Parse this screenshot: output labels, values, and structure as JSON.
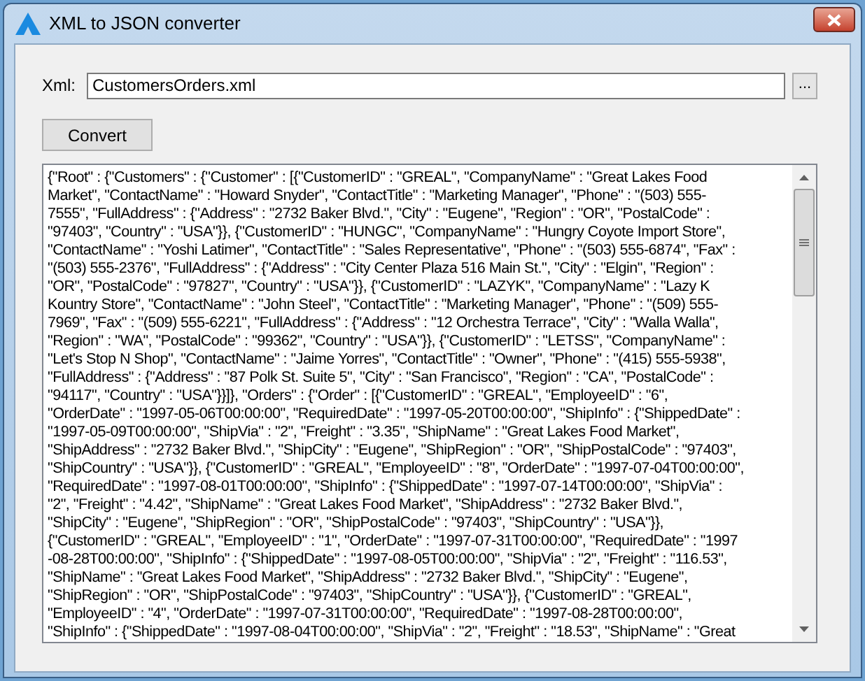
{
  "window": {
    "title": "XML to JSON converter"
  },
  "xml_field": {
    "label": "Xml:",
    "value": "CustomersOrders.xml"
  },
  "browse_button": "...",
  "convert_button": "Convert",
  "output_lines": [
    "{\"Root\" : {\"Customers\" : {\"Customer\" : [{\"CustomerID\" : \"GREAL\", \"CompanyName\" : \"Great Lakes Food",
    "Market\", \"ContactName\" : \"Howard Snyder\", \"ContactTitle\" : \"Marketing Manager\", \"Phone\" : \"(503) 555-",
    "7555\", \"FullAddress\" : {\"Address\" : \"2732 Baker Blvd.\", \"City\" : \"Eugene\", \"Region\" : \"OR\", \"PostalCode\" :",
    "\"97403\", \"Country\" : \"USA\"}}, {\"CustomerID\" : \"HUNGC\", \"CompanyName\" : \"Hungry Coyote Import Store\",",
    "\"ContactName\" : \"Yoshi Latimer\", \"ContactTitle\" : \"Sales Representative\", \"Phone\" : \"(503) 555-6874\", \"Fax\" :",
    "\"(503) 555-2376\", \"FullAddress\" : {\"Address\" : \"City Center Plaza 516 Main St.\", \"City\" : \"Elgin\", \"Region\" :",
    "\"OR\", \"PostalCode\" : \"97827\", \"Country\" : \"USA\"}}, {\"CustomerID\" : \"LAZYK\", \"CompanyName\" : \"Lazy K",
    "Kountry Store\", \"ContactName\" : \"John Steel\", \"ContactTitle\" : \"Marketing Manager\", \"Phone\" : \"(509) 555-",
    "7969\", \"Fax\" : \"(509) 555-6221\", \"FullAddress\" : {\"Address\" : \"12 Orchestra Terrace\", \"City\" : \"Walla Walla\",",
    "\"Region\" : \"WA\", \"PostalCode\" : \"99362\", \"Country\" : \"USA\"}}, {\"CustomerID\" : \"LETSS\", \"CompanyName\" :",
    "\"Let's Stop N Shop\", \"ContactName\" : \"Jaime Yorres\", \"ContactTitle\" : \"Owner\", \"Phone\" : \"(415) 555-5938\",",
    "\"FullAddress\" : {\"Address\" : \"87 Polk St. Suite 5\", \"City\" : \"San Francisco\", \"Region\" : \"CA\", \"PostalCode\" :",
    "\"94117\", \"Country\" : \"USA\"}}]}, \"Orders\" : {\"Order\" : [{\"CustomerID\" : \"GREAL\", \"EmployeeID\" : \"6\",",
    "\"OrderDate\" : \"1997-05-06T00:00:00\", \"RequiredDate\" : \"1997-05-20T00:00:00\", \"ShipInfo\" : {\"ShippedDate\" :",
    "\"1997-05-09T00:00:00\", \"ShipVia\" : \"2\", \"Freight\" : \"3.35\", \"ShipName\" : \"Great Lakes Food Market\",",
    "\"ShipAddress\" : \"2732 Baker Blvd.\", \"ShipCity\" : \"Eugene\", \"ShipRegion\" : \"OR\", \"ShipPostalCode\" : \"97403\",",
    "\"ShipCountry\" : \"USA\"}}, {\"CustomerID\" : \"GREAL\", \"EmployeeID\" : \"8\", \"OrderDate\" : \"1997-07-04T00:00:00\",",
    "\"RequiredDate\" : \"1997-08-01T00:00:00\", \"ShipInfo\" : {\"ShippedDate\" : \"1997-07-14T00:00:00\", \"ShipVia\" :",
    "\"2\", \"Freight\" : \"4.42\", \"ShipName\" : \"Great Lakes Food Market\", \"ShipAddress\" : \"2732 Baker Blvd.\",",
    "\"ShipCity\" : \"Eugene\", \"ShipRegion\" : \"OR\", \"ShipPostalCode\" : \"97403\", \"ShipCountry\" : \"USA\"}},",
    "{\"CustomerID\" : \"GREAL\", \"EmployeeID\" : \"1\", \"OrderDate\" : \"1997-07-31T00:00:00\", \"RequiredDate\" : \"1997",
    "-08-28T00:00:00\", \"ShipInfo\" : {\"ShippedDate\" : \"1997-08-05T00:00:00\", \"ShipVia\" : \"2\", \"Freight\" : \"116.53\",",
    "\"ShipName\" : \"Great Lakes Food Market\", \"ShipAddress\" : \"2732 Baker Blvd.\", \"ShipCity\" : \"Eugene\",",
    "\"ShipRegion\" : \"OR\", \"ShipPostalCode\" : \"97403\", \"ShipCountry\" : \"USA\"}}, {\"CustomerID\" : \"GREAL\",",
    "\"EmployeeID\" : \"4\", \"OrderDate\" : \"1997-07-31T00:00:00\", \"RequiredDate\" : \"1997-08-28T00:00:00\",",
    "\"ShipInfo\" : {\"ShippedDate\" : \"1997-08-04T00:00:00\", \"ShipVia\" : \"2\", \"Freight\" : \"18.53\", \"ShipName\" : \"Great"
  ]
}
